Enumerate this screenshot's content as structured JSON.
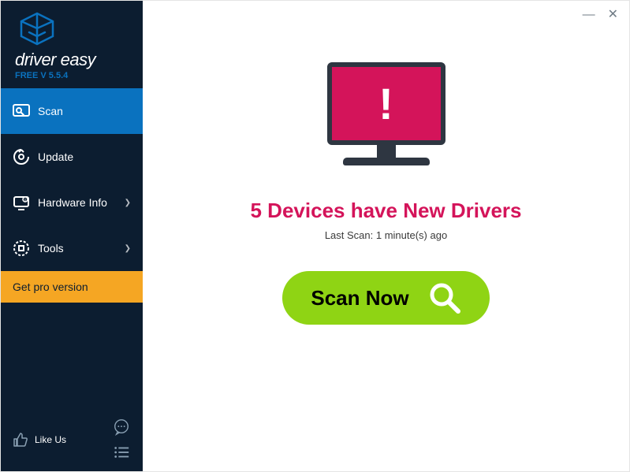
{
  "brand": {
    "name": "driver easy",
    "version": "FREE V 5.5.4"
  },
  "sidebar": {
    "items": [
      {
        "label": "Scan",
        "active": true
      },
      {
        "label": "Update"
      },
      {
        "label": "Hardware Info",
        "chevron": true
      },
      {
        "label": "Tools",
        "chevron": true
      }
    ],
    "get_pro": "Get pro version",
    "like_us": "Like Us"
  },
  "main": {
    "status_title": "5 Devices have New Drivers",
    "last_scan": "Last Scan: 1 minute(s) ago",
    "scan_button": "Scan Now"
  }
}
